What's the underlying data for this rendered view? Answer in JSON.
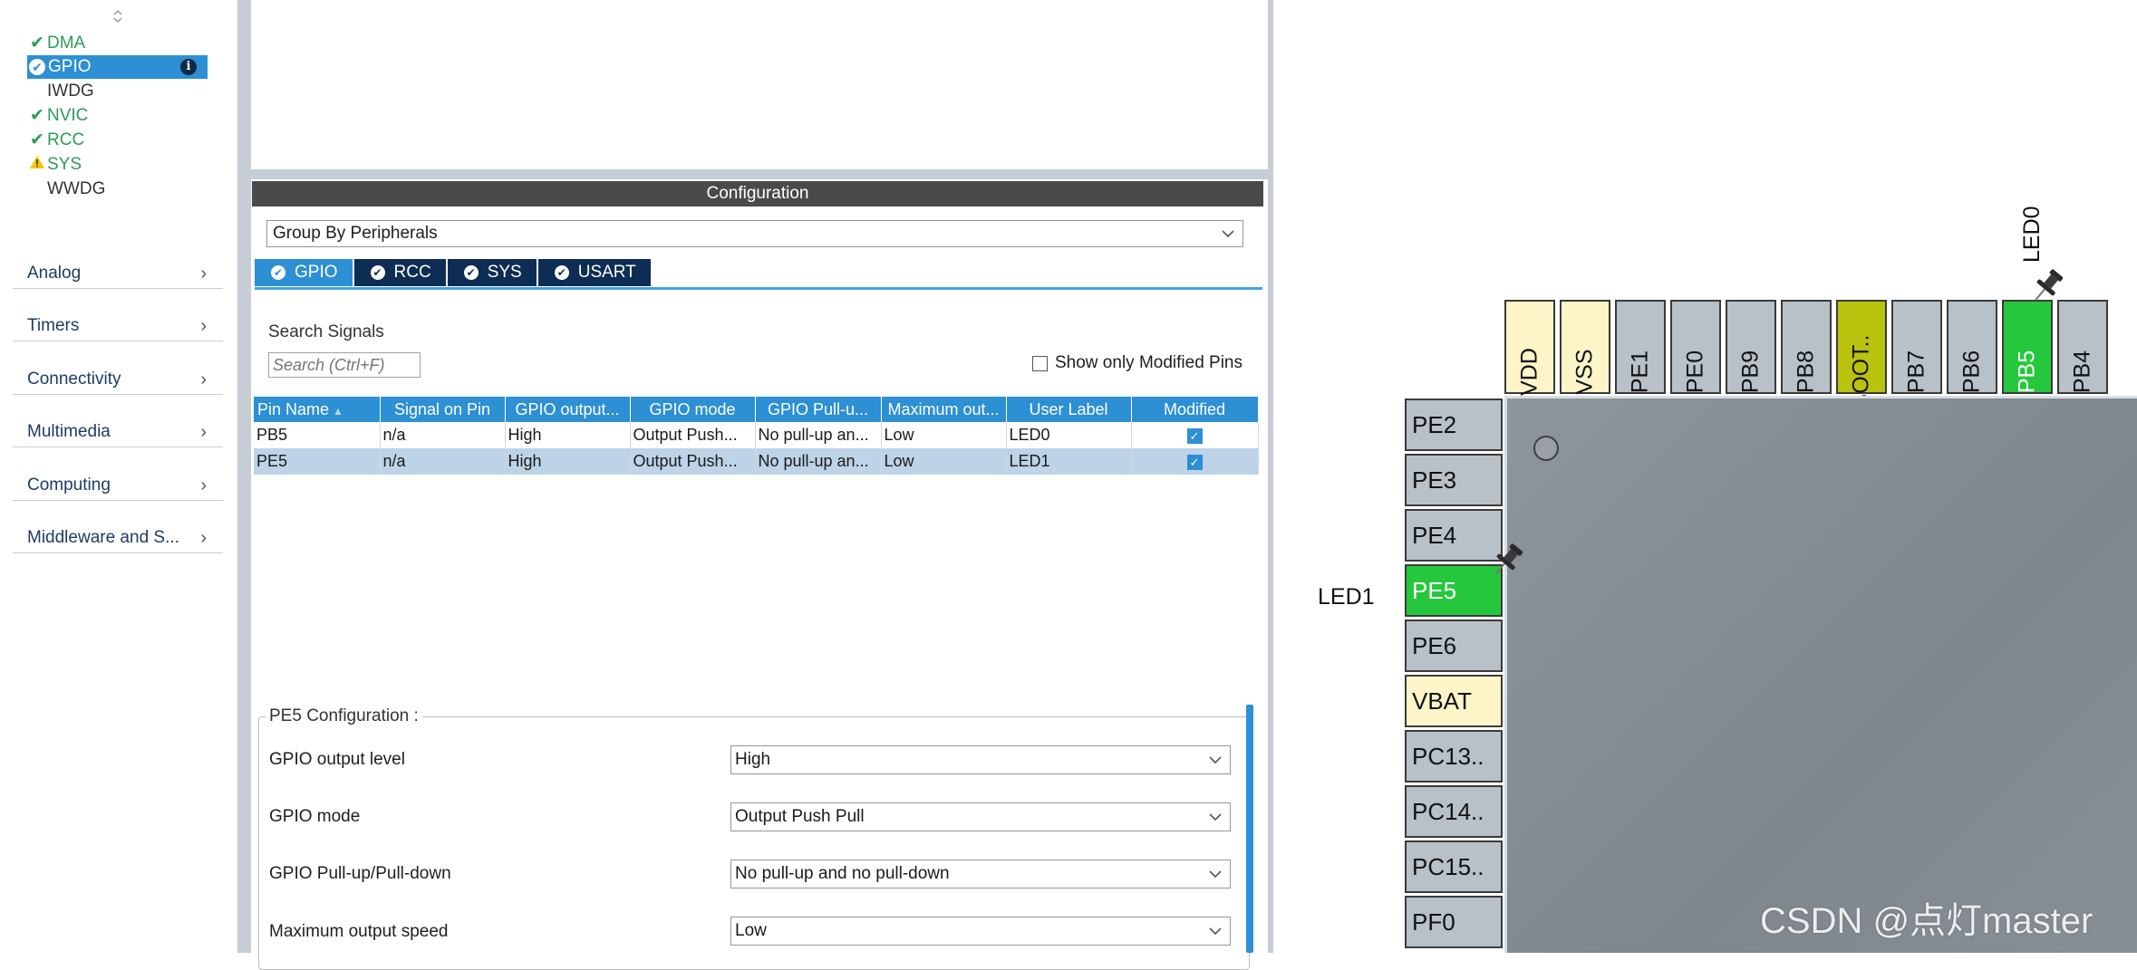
{
  "sidebar": {
    "peripherals": [
      {
        "label": "DMA",
        "status": "ok"
      },
      {
        "label": "GPIO",
        "status": "selected"
      },
      {
        "label": "IWDG",
        "status": "none"
      },
      {
        "label": "NVIC",
        "status": "ok"
      },
      {
        "label": "RCC",
        "status": "ok"
      },
      {
        "label": "SYS",
        "status": "warning"
      },
      {
        "label": "WWDG",
        "status": "none"
      }
    ],
    "info_icon": "i",
    "categories": [
      {
        "label": "Analog"
      },
      {
        "label": "Timers"
      },
      {
        "label": "Connectivity"
      },
      {
        "label": "Multimedia"
      },
      {
        "label": "Computing"
      },
      {
        "label": "Middleware and S..."
      }
    ]
  },
  "config": {
    "header": "Configuration",
    "group_by": "Group By Peripherals",
    "tabs": [
      {
        "label": "GPIO",
        "active": true
      },
      {
        "label": "RCC",
        "active": false
      },
      {
        "label": "SYS",
        "active": false
      },
      {
        "label": "USART",
        "active": false
      }
    ],
    "search_label": "Search Signals",
    "search_placeholder": "Search (Ctrl+F)",
    "show_modified_label": "Show only Modified Pins",
    "table": {
      "columns": [
        "Pin Name",
        "Signal on Pin",
        "GPIO output...",
        "GPIO mode",
        "GPIO Pull-u...",
        "Maximum out...",
        "User Label",
        "Modified"
      ],
      "rows": [
        {
          "pin": "PB5",
          "signal": "n/a",
          "output": "High",
          "mode": "Output Push...",
          "pull": "No pull-up an...",
          "speed": "Low",
          "label": "LED0",
          "modified": true
        },
        {
          "pin": "PE5",
          "signal": "n/a",
          "output": "High",
          "mode": "Output Push...",
          "pull": "No pull-up an...",
          "speed": "Low",
          "label": "LED1",
          "modified": true
        }
      ]
    },
    "pe5": {
      "title": "PE5 Configuration :",
      "fields": [
        {
          "label": "GPIO output level",
          "value": "High"
        },
        {
          "label": "GPIO mode",
          "value": "Output Push Pull"
        },
        {
          "label": "GPIO Pull-up/Pull-down",
          "value": "No pull-up and no pull-down"
        },
        {
          "label": "Maximum output speed",
          "value": "Low"
        }
      ]
    }
  },
  "chip": {
    "top_pins": [
      "VDD",
      "VSS",
      "PE1",
      "PE0",
      "PB9",
      "PB8",
      "BOOT..",
      "PB7",
      "PB6",
      "PB5",
      "PB4"
    ],
    "left_pins": [
      "PE2",
      "PE3",
      "PE4",
      "PE5",
      "PE6",
      "VBAT",
      "PC13..",
      "PC14..",
      "PC15..",
      "PF0"
    ],
    "signal_labels": {
      "pb5": "LED0",
      "pe5": "LED1"
    },
    "colors": {
      "active_pin": "#25c83c",
      "power_pin": "#fdf5c8",
      "boot_pin": "#b9c20c",
      "default_pin": "#b8c0c8"
    }
  },
  "watermark": "CSDN @点灯master",
  "colors": {
    "accent": "#2d8fd4",
    "dark_tab": "#0e2d54",
    "ok_green": "#2f9a5a",
    "warn_yellow": "#e8b800"
  }
}
